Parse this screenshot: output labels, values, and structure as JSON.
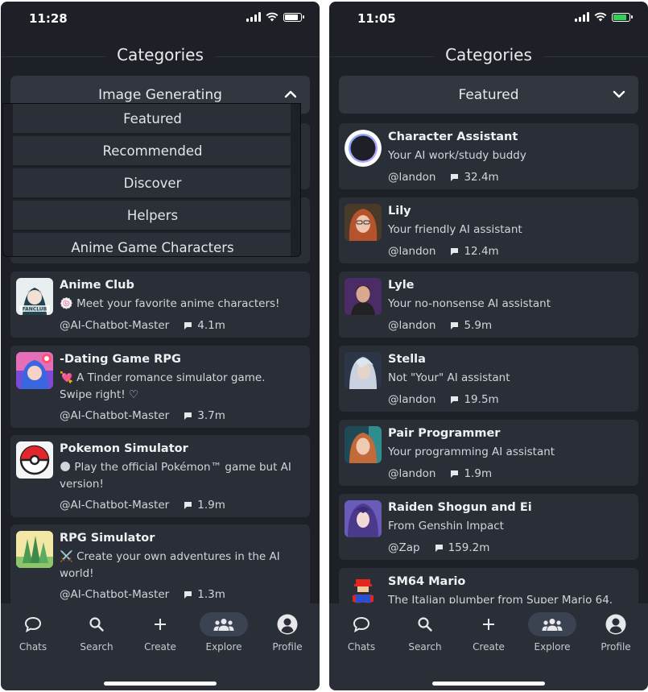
{
  "left": {
    "status": {
      "time": "11:28"
    },
    "title": "Categories",
    "dropdown": {
      "selected": "Image Generating",
      "expanded": true
    },
    "menu": [
      "Featured",
      "Recommended",
      "Discover",
      "Helpers",
      "Anime Game Characters"
    ],
    "cards": [
      {
        "title": "Anime Club",
        "desc": "🍥 Meet your favorite anime characters!",
        "author": "@AI-Chatbot-Master",
        "count": "4.1m"
      },
      {
        "title": "-Dating Game RPG",
        "desc": "💘 A Tinder romance simulator game. Swipe right! ♡",
        "author": "@AI-Chatbot-Master",
        "count": "3.7m"
      },
      {
        "title": "Pokemon Simulator",
        "desc": "🌑 Play the official Pokémon™ game but AI version!",
        "author": "@AI-Chatbot-Master",
        "count": "1.9m"
      },
      {
        "title": "RPG Simulator",
        "desc": "⚔️ Create your own adventures in the AI world!",
        "author": "@AI-Chatbot-Master",
        "count": "1.3m"
      }
    ]
  },
  "right": {
    "status": {
      "time": "11:05"
    },
    "title": "Categories",
    "dropdown": {
      "selected": "Featured",
      "expanded": false
    },
    "cards": [
      {
        "title": "Character Assistant",
        "desc": "Your AI work/study buddy",
        "author": "@landon",
        "count": "32.4m"
      },
      {
        "title": "Lily",
        "desc": "Your friendly AI assistant",
        "author": "@landon",
        "count": "12.4m"
      },
      {
        "title": "Lyle",
        "desc": "Your no-nonsense AI assistant",
        "author": "@landon",
        "count": "5.9m"
      },
      {
        "title": "Stella",
        "desc": "Not \"Your\" AI assistant",
        "author": "@landon",
        "count": "19.5m"
      },
      {
        "title": "Pair Programmer",
        "desc": "Your programming AI assistant",
        "author": "@landon",
        "count": "1.9m"
      },
      {
        "title": "Raiden Shogun and Ei",
        "desc": "From Genshin Impact",
        "author": "@Zap",
        "count": "159.2m"
      },
      {
        "title": "SM64 Mario",
        "desc": "The Italian plumber from Super Mario 64.",
        "author": "",
        "count": ""
      }
    ]
  },
  "tabs": [
    "Chats",
    "Search",
    "Create",
    "Explore",
    "Profile"
  ],
  "active_tab": "Explore",
  "icons": {
    "chat": "chat-bubble-icon",
    "search": "magnifier-icon",
    "create": "plus-icon",
    "explore": "people-group-icon",
    "profile": "user-circle-icon",
    "message-count": "message-count-icon"
  },
  "colors": {
    "background": "#1d2026",
    "card": "#2a2e36",
    "dropdown": "#31363f",
    "active_tab": "#3b4352",
    "battery_charging": "#30d158"
  }
}
